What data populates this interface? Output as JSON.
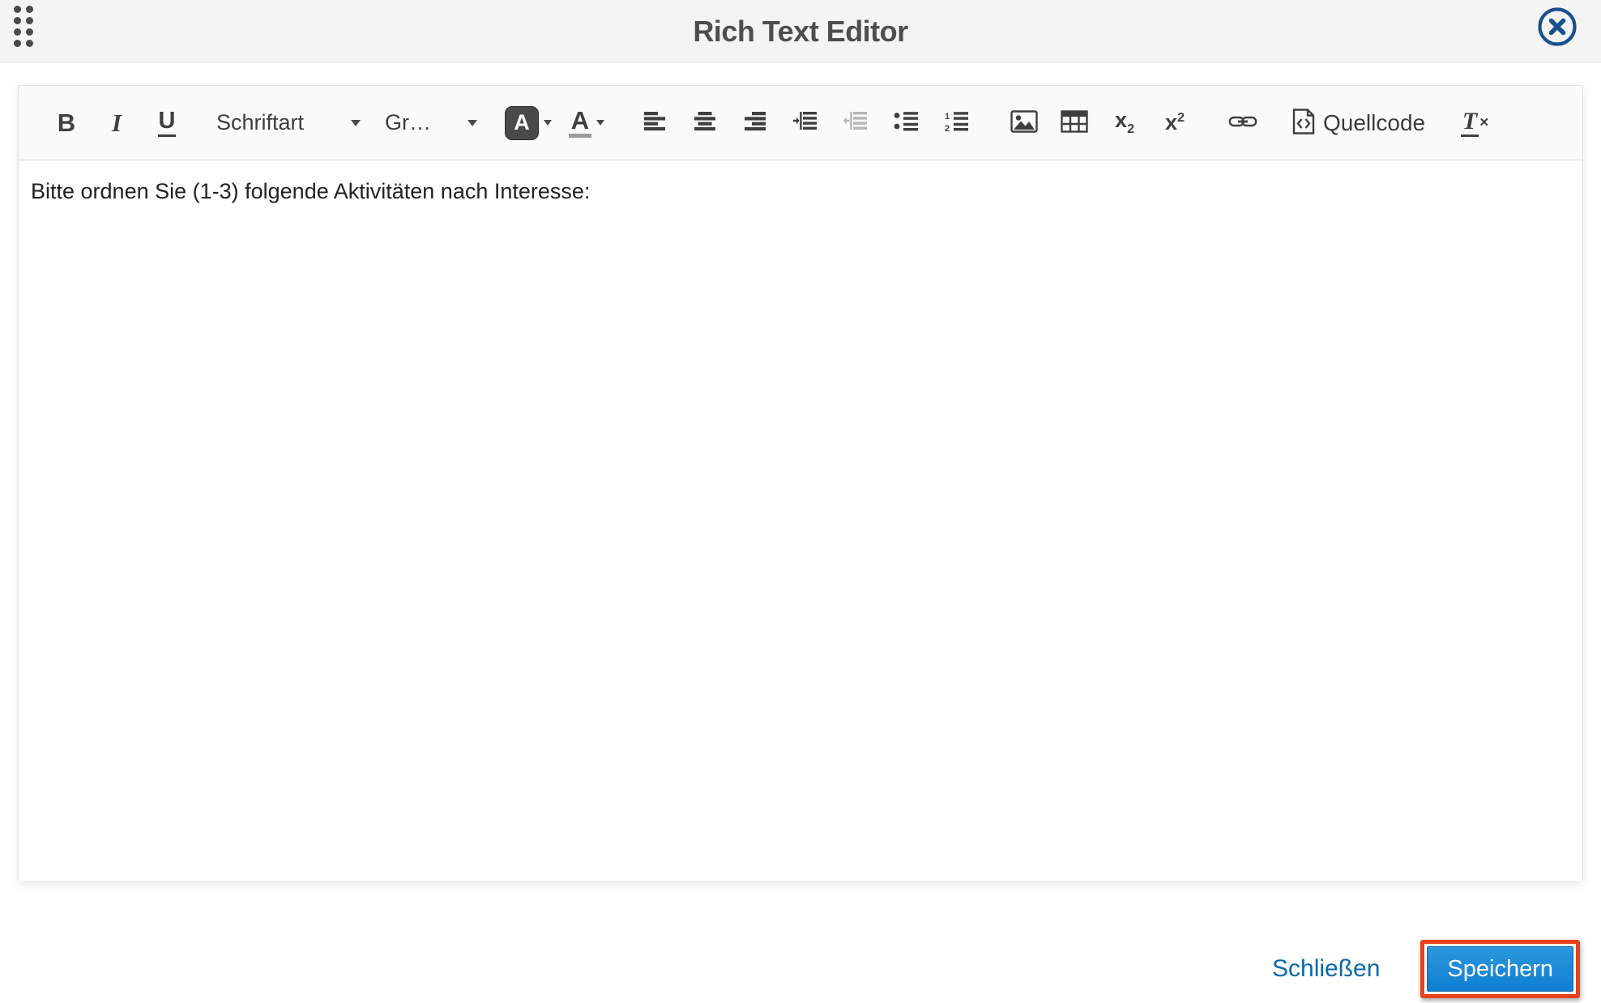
{
  "header": {
    "title": "Rich Text Editor"
  },
  "icons": {
    "chevron_down": "drawn-as-css-triangle",
    "close": "circle-x",
    "drag_handle": "eight-dots-grid"
  },
  "toolbar": {
    "bold": "B",
    "italic": "I",
    "underline": "U",
    "font_family_label": "Schriftart",
    "font_size_label": "Gr…",
    "bg_color_letter": "A",
    "text_color_letter": "A",
    "subscript_base": "x",
    "subscript_small": "2",
    "superscript_base": "x",
    "superscript_small": "2",
    "source_label": "Quellcode",
    "remove_format_letter": "T",
    "remove_format_x": "×"
  },
  "editor": {
    "content": "Bitte ordnen Sie (1-3) folgende Aktivitäten nach Interesse:"
  },
  "footer": {
    "close_label": "Schließen",
    "save_label": "Speichern"
  },
  "colors": {
    "header_bg": "#f4f4f4",
    "title_text": "#4e4e4e",
    "close_icon_blue": "#1a508e",
    "toolbar_bg": "#fafafa",
    "icon_gray": "#3f3f3f",
    "icon_disabled": "#b6b6b6",
    "link_blue": "#0b69a9",
    "save_button_blue": "#1287d2",
    "highlight_red": "#e8411d"
  }
}
